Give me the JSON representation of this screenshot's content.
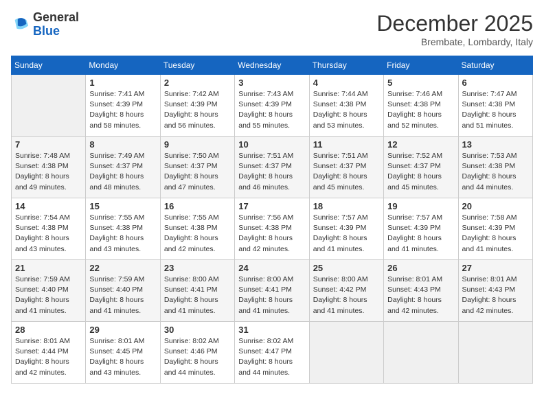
{
  "header": {
    "logo_line1": "General",
    "logo_line2": "Blue",
    "month": "December 2025",
    "location": "Brembate, Lombardy, Italy"
  },
  "days_of_week": [
    "Sunday",
    "Monday",
    "Tuesday",
    "Wednesday",
    "Thursday",
    "Friday",
    "Saturday"
  ],
  "weeks": [
    [
      {
        "day": "",
        "sunrise": "",
        "sunset": "",
        "daylight": ""
      },
      {
        "day": "1",
        "sunrise": "Sunrise: 7:41 AM",
        "sunset": "Sunset: 4:39 PM",
        "daylight": "Daylight: 8 hours and 58 minutes."
      },
      {
        "day": "2",
        "sunrise": "Sunrise: 7:42 AM",
        "sunset": "Sunset: 4:39 PM",
        "daylight": "Daylight: 8 hours and 56 minutes."
      },
      {
        "day": "3",
        "sunrise": "Sunrise: 7:43 AM",
        "sunset": "Sunset: 4:39 PM",
        "daylight": "Daylight: 8 hours and 55 minutes."
      },
      {
        "day": "4",
        "sunrise": "Sunrise: 7:44 AM",
        "sunset": "Sunset: 4:38 PM",
        "daylight": "Daylight: 8 hours and 53 minutes."
      },
      {
        "day": "5",
        "sunrise": "Sunrise: 7:46 AM",
        "sunset": "Sunset: 4:38 PM",
        "daylight": "Daylight: 8 hours and 52 minutes."
      },
      {
        "day": "6",
        "sunrise": "Sunrise: 7:47 AM",
        "sunset": "Sunset: 4:38 PM",
        "daylight": "Daylight: 8 hours and 51 minutes."
      }
    ],
    [
      {
        "day": "7",
        "sunrise": "Sunrise: 7:48 AM",
        "sunset": "Sunset: 4:38 PM",
        "daylight": "Daylight: 8 hours and 49 minutes."
      },
      {
        "day": "8",
        "sunrise": "Sunrise: 7:49 AM",
        "sunset": "Sunset: 4:37 PM",
        "daylight": "Daylight: 8 hours and 48 minutes."
      },
      {
        "day": "9",
        "sunrise": "Sunrise: 7:50 AM",
        "sunset": "Sunset: 4:37 PM",
        "daylight": "Daylight: 8 hours and 47 minutes."
      },
      {
        "day": "10",
        "sunrise": "Sunrise: 7:51 AM",
        "sunset": "Sunset: 4:37 PM",
        "daylight": "Daylight: 8 hours and 46 minutes."
      },
      {
        "day": "11",
        "sunrise": "Sunrise: 7:51 AM",
        "sunset": "Sunset: 4:37 PM",
        "daylight": "Daylight: 8 hours and 45 minutes."
      },
      {
        "day": "12",
        "sunrise": "Sunrise: 7:52 AM",
        "sunset": "Sunset: 4:37 PM",
        "daylight": "Daylight: 8 hours and 45 minutes."
      },
      {
        "day": "13",
        "sunrise": "Sunrise: 7:53 AM",
        "sunset": "Sunset: 4:38 PM",
        "daylight": "Daylight: 8 hours and 44 minutes."
      }
    ],
    [
      {
        "day": "14",
        "sunrise": "Sunrise: 7:54 AM",
        "sunset": "Sunset: 4:38 PM",
        "daylight": "Daylight: 8 hours and 43 minutes."
      },
      {
        "day": "15",
        "sunrise": "Sunrise: 7:55 AM",
        "sunset": "Sunset: 4:38 PM",
        "daylight": "Daylight: 8 hours and 43 minutes."
      },
      {
        "day": "16",
        "sunrise": "Sunrise: 7:55 AM",
        "sunset": "Sunset: 4:38 PM",
        "daylight": "Daylight: 8 hours and 42 minutes."
      },
      {
        "day": "17",
        "sunrise": "Sunrise: 7:56 AM",
        "sunset": "Sunset: 4:38 PM",
        "daylight": "Daylight: 8 hours and 42 minutes."
      },
      {
        "day": "18",
        "sunrise": "Sunrise: 7:57 AM",
        "sunset": "Sunset: 4:39 PM",
        "daylight": "Daylight: 8 hours and 41 minutes."
      },
      {
        "day": "19",
        "sunrise": "Sunrise: 7:57 AM",
        "sunset": "Sunset: 4:39 PM",
        "daylight": "Daylight: 8 hours and 41 minutes."
      },
      {
        "day": "20",
        "sunrise": "Sunrise: 7:58 AM",
        "sunset": "Sunset: 4:39 PM",
        "daylight": "Daylight: 8 hours and 41 minutes."
      }
    ],
    [
      {
        "day": "21",
        "sunrise": "Sunrise: 7:59 AM",
        "sunset": "Sunset: 4:40 PM",
        "daylight": "Daylight: 8 hours and 41 minutes."
      },
      {
        "day": "22",
        "sunrise": "Sunrise: 7:59 AM",
        "sunset": "Sunset: 4:40 PM",
        "daylight": "Daylight: 8 hours and 41 minutes."
      },
      {
        "day": "23",
        "sunrise": "Sunrise: 8:00 AM",
        "sunset": "Sunset: 4:41 PM",
        "daylight": "Daylight: 8 hours and 41 minutes."
      },
      {
        "day": "24",
        "sunrise": "Sunrise: 8:00 AM",
        "sunset": "Sunset: 4:41 PM",
        "daylight": "Daylight: 8 hours and 41 minutes."
      },
      {
        "day": "25",
        "sunrise": "Sunrise: 8:00 AM",
        "sunset": "Sunset: 4:42 PM",
        "daylight": "Daylight: 8 hours and 41 minutes."
      },
      {
        "day": "26",
        "sunrise": "Sunrise: 8:01 AM",
        "sunset": "Sunset: 4:43 PM",
        "daylight": "Daylight: 8 hours and 42 minutes."
      },
      {
        "day": "27",
        "sunrise": "Sunrise: 8:01 AM",
        "sunset": "Sunset: 4:43 PM",
        "daylight": "Daylight: 8 hours and 42 minutes."
      }
    ],
    [
      {
        "day": "28",
        "sunrise": "Sunrise: 8:01 AM",
        "sunset": "Sunset: 4:44 PM",
        "daylight": "Daylight: 8 hours and 42 minutes."
      },
      {
        "day": "29",
        "sunrise": "Sunrise: 8:01 AM",
        "sunset": "Sunset: 4:45 PM",
        "daylight": "Daylight: 8 hours and 43 minutes."
      },
      {
        "day": "30",
        "sunrise": "Sunrise: 8:02 AM",
        "sunset": "Sunset: 4:46 PM",
        "daylight": "Daylight: 8 hours and 44 minutes."
      },
      {
        "day": "31",
        "sunrise": "Sunrise: 8:02 AM",
        "sunset": "Sunset: 4:47 PM",
        "daylight": "Daylight: 8 hours and 44 minutes."
      },
      {
        "day": "",
        "sunrise": "",
        "sunset": "",
        "daylight": ""
      },
      {
        "day": "",
        "sunrise": "",
        "sunset": "",
        "daylight": ""
      },
      {
        "day": "",
        "sunrise": "",
        "sunset": "",
        "daylight": ""
      }
    ]
  ]
}
